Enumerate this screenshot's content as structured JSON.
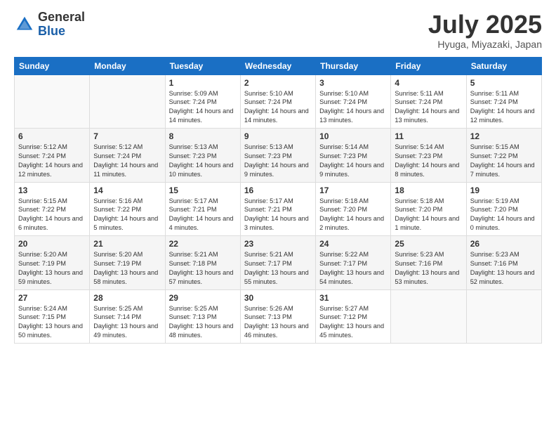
{
  "logo": {
    "general": "General",
    "blue": "Blue"
  },
  "title": "July 2025",
  "subtitle": "Hyuga, Miyazaki, Japan",
  "header_days": [
    "Sunday",
    "Monday",
    "Tuesday",
    "Wednesday",
    "Thursday",
    "Friday",
    "Saturday"
  ],
  "weeks": [
    [
      {
        "day": "",
        "info": ""
      },
      {
        "day": "",
        "info": ""
      },
      {
        "day": "1",
        "info": "Sunrise: 5:09 AM\nSunset: 7:24 PM\nDaylight: 14 hours and 14 minutes."
      },
      {
        "day": "2",
        "info": "Sunrise: 5:10 AM\nSunset: 7:24 PM\nDaylight: 14 hours and 14 minutes."
      },
      {
        "day": "3",
        "info": "Sunrise: 5:10 AM\nSunset: 7:24 PM\nDaylight: 14 hours and 13 minutes."
      },
      {
        "day": "4",
        "info": "Sunrise: 5:11 AM\nSunset: 7:24 PM\nDaylight: 14 hours and 13 minutes."
      },
      {
        "day": "5",
        "info": "Sunrise: 5:11 AM\nSunset: 7:24 PM\nDaylight: 14 hours and 12 minutes."
      }
    ],
    [
      {
        "day": "6",
        "info": "Sunrise: 5:12 AM\nSunset: 7:24 PM\nDaylight: 14 hours and 12 minutes."
      },
      {
        "day": "7",
        "info": "Sunrise: 5:12 AM\nSunset: 7:24 PM\nDaylight: 14 hours and 11 minutes."
      },
      {
        "day": "8",
        "info": "Sunrise: 5:13 AM\nSunset: 7:23 PM\nDaylight: 14 hours and 10 minutes."
      },
      {
        "day": "9",
        "info": "Sunrise: 5:13 AM\nSunset: 7:23 PM\nDaylight: 14 hours and 9 minutes."
      },
      {
        "day": "10",
        "info": "Sunrise: 5:14 AM\nSunset: 7:23 PM\nDaylight: 14 hours and 9 minutes."
      },
      {
        "day": "11",
        "info": "Sunrise: 5:14 AM\nSunset: 7:23 PM\nDaylight: 14 hours and 8 minutes."
      },
      {
        "day": "12",
        "info": "Sunrise: 5:15 AM\nSunset: 7:22 PM\nDaylight: 14 hours and 7 minutes."
      }
    ],
    [
      {
        "day": "13",
        "info": "Sunrise: 5:15 AM\nSunset: 7:22 PM\nDaylight: 14 hours and 6 minutes."
      },
      {
        "day": "14",
        "info": "Sunrise: 5:16 AM\nSunset: 7:22 PM\nDaylight: 14 hours and 5 minutes."
      },
      {
        "day": "15",
        "info": "Sunrise: 5:17 AM\nSunset: 7:21 PM\nDaylight: 14 hours and 4 minutes."
      },
      {
        "day": "16",
        "info": "Sunrise: 5:17 AM\nSunset: 7:21 PM\nDaylight: 14 hours and 3 minutes."
      },
      {
        "day": "17",
        "info": "Sunrise: 5:18 AM\nSunset: 7:20 PM\nDaylight: 14 hours and 2 minutes."
      },
      {
        "day": "18",
        "info": "Sunrise: 5:18 AM\nSunset: 7:20 PM\nDaylight: 14 hours and 1 minute."
      },
      {
        "day": "19",
        "info": "Sunrise: 5:19 AM\nSunset: 7:20 PM\nDaylight: 14 hours and 0 minutes."
      }
    ],
    [
      {
        "day": "20",
        "info": "Sunrise: 5:20 AM\nSunset: 7:19 PM\nDaylight: 13 hours and 59 minutes."
      },
      {
        "day": "21",
        "info": "Sunrise: 5:20 AM\nSunset: 7:19 PM\nDaylight: 13 hours and 58 minutes."
      },
      {
        "day": "22",
        "info": "Sunrise: 5:21 AM\nSunset: 7:18 PM\nDaylight: 13 hours and 57 minutes."
      },
      {
        "day": "23",
        "info": "Sunrise: 5:21 AM\nSunset: 7:17 PM\nDaylight: 13 hours and 55 minutes."
      },
      {
        "day": "24",
        "info": "Sunrise: 5:22 AM\nSunset: 7:17 PM\nDaylight: 13 hours and 54 minutes."
      },
      {
        "day": "25",
        "info": "Sunrise: 5:23 AM\nSunset: 7:16 PM\nDaylight: 13 hours and 53 minutes."
      },
      {
        "day": "26",
        "info": "Sunrise: 5:23 AM\nSunset: 7:16 PM\nDaylight: 13 hours and 52 minutes."
      }
    ],
    [
      {
        "day": "27",
        "info": "Sunrise: 5:24 AM\nSunset: 7:15 PM\nDaylight: 13 hours and 50 minutes."
      },
      {
        "day": "28",
        "info": "Sunrise: 5:25 AM\nSunset: 7:14 PM\nDaylight: 13 hours and 49 minutes."
      },
      {
        "day": "29",
        "info": "Sunrise: 5:25 AM\nSunset: 7:13 PM\nDaylight: 13 hours and 48 minutes."
      },
      {
        "day": "30",
        "info": "Sunrise: 5:26 AM\nSunset: 7:13 PM\nDaylight: 13 hours and 46 minutes."
      },
      {
        "day": "31",
        "info": "Sunrise: 5:27 AM\nSunset: 7:12 PM\nDaylight: 13 hours and 45 minutes."
      },
      {
        "day": "",
        "info": ""
      },
      {
        "day": "",
        "info": ""
      }
    ]
  ]
}
